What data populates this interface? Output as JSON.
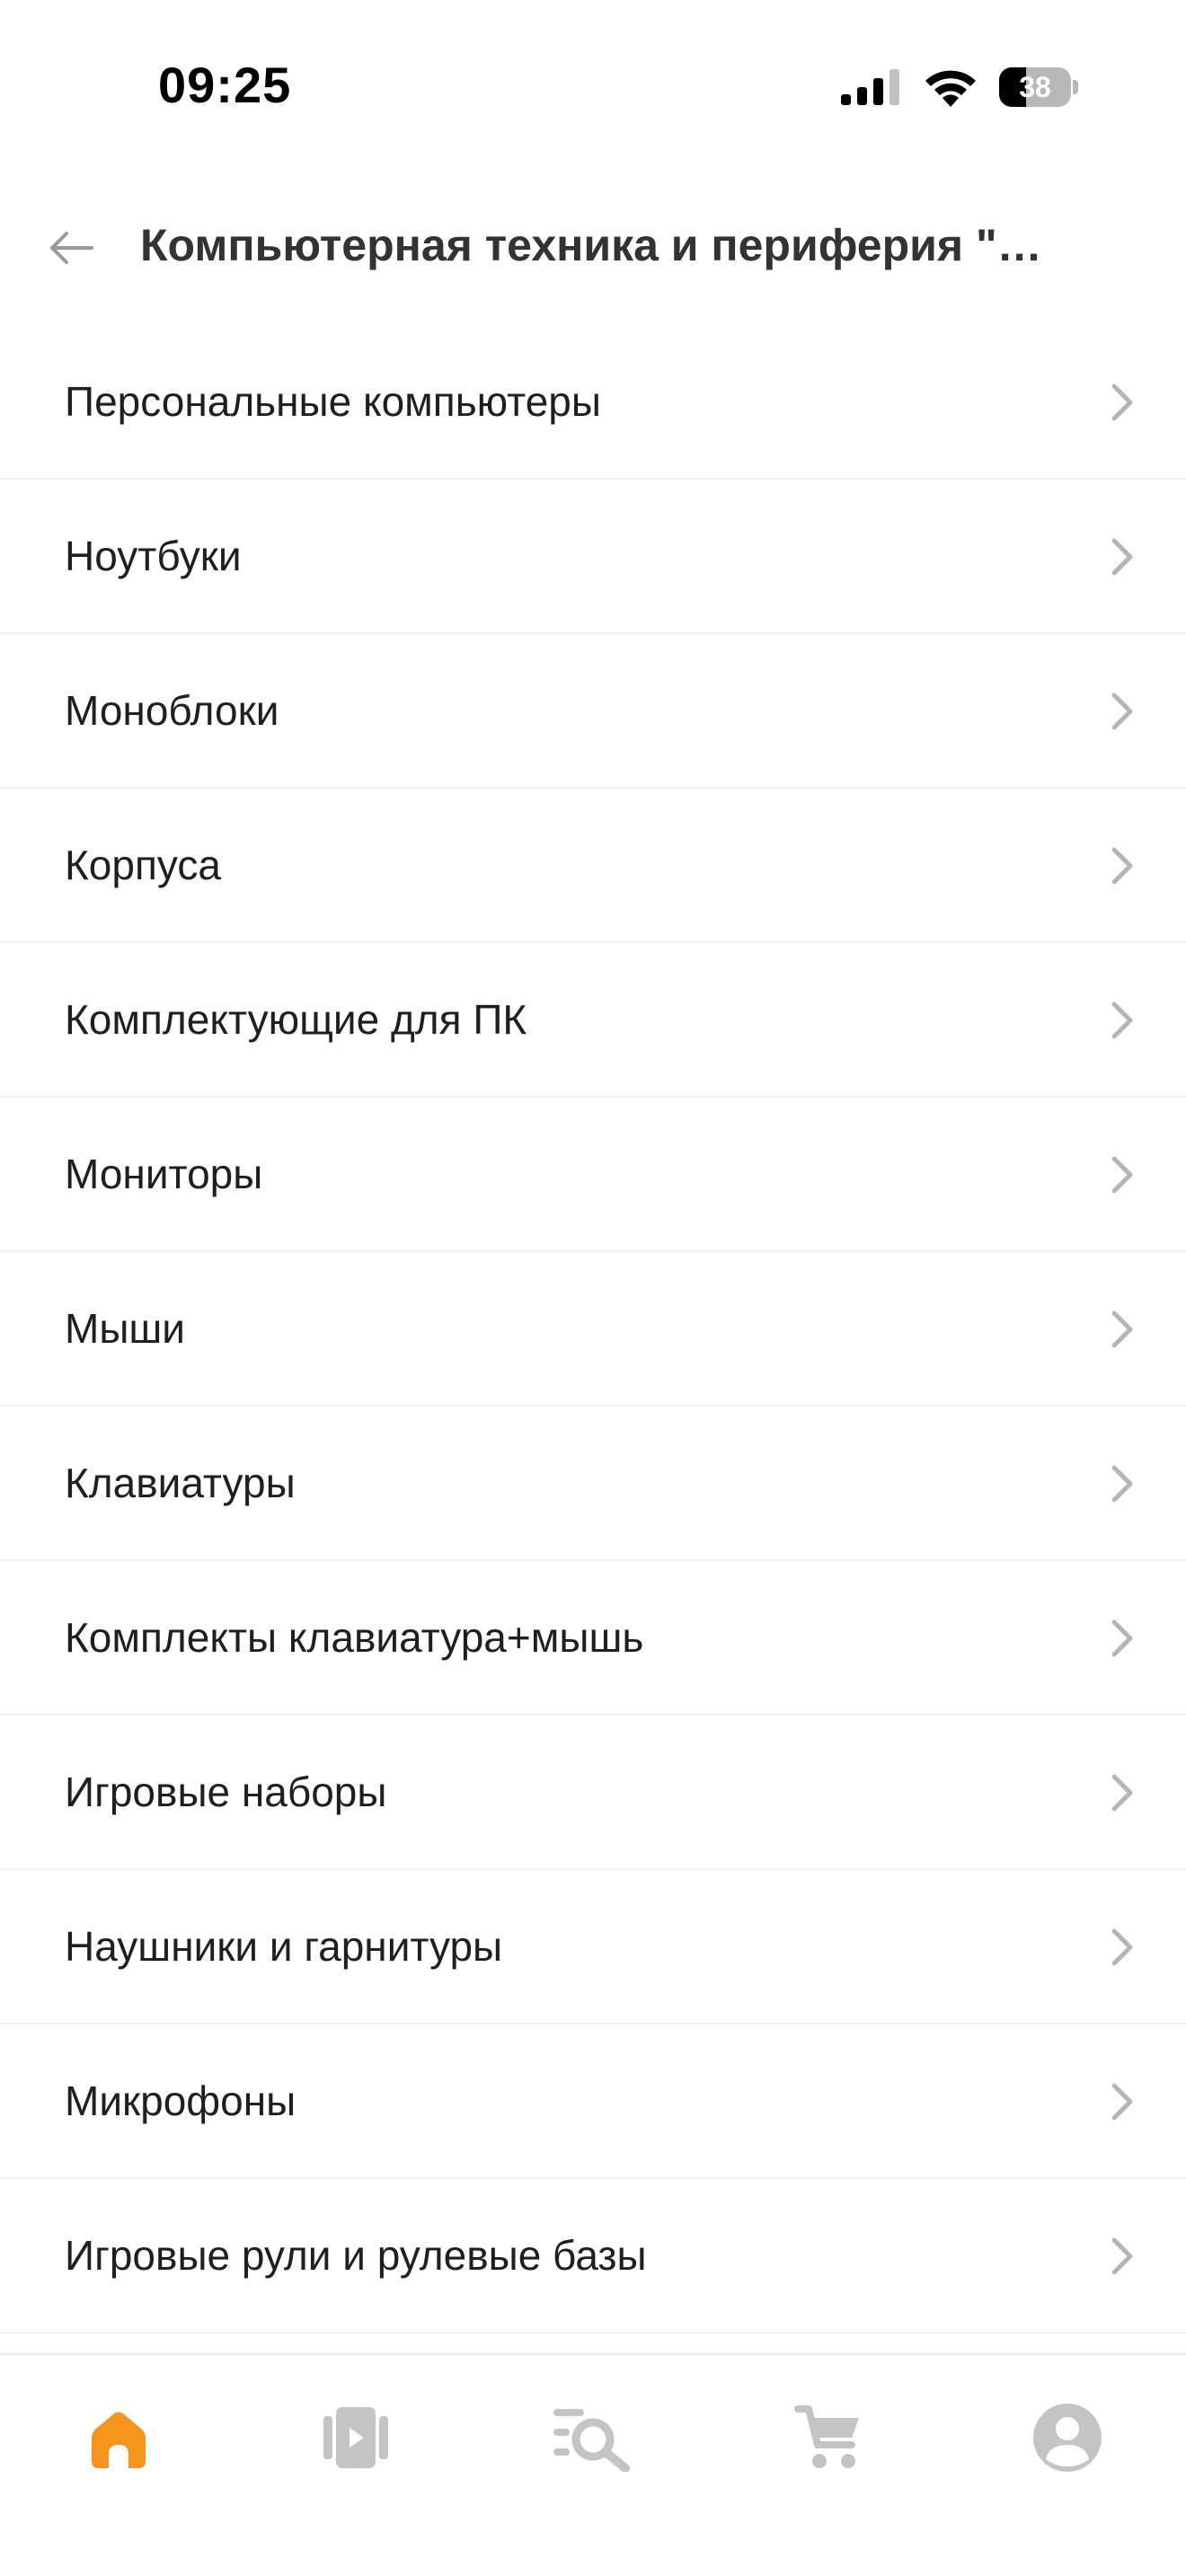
{
  "status_bar": {
    "time": "09:25",
    "battery_level": "38"
  },
  "header": {
    "title": "Компьютерная техника и периферия \"Со..."
  },
  "categories": [
    {
      "label": "Персональные компьютеры"
    },
    {
      "label": "Ноутбуки"
    },
    {
      "label": "Моноблоки"
    },
    {
      "label": "Корпуса"
    },
    {
      "label": "Комплектующие для ПК"
    },
    {
      "label": "Мониторы"
    },
    {
      "label": "Мыши"
    },
    {
      "label": "Клавиатуры"
    },
    {
      "label": "Комплекты клавиатура+мышь"
    },
    {
      "label": "Игровые наборы"
    },
    {
      "label": "Наушники и гарнитуры"
    },
    {
      "label": "Микрофоны"
    },
    {
      "label": "Игровые рули и рулевые базы"
    }
  ],
  "bottom_nav": {
    "items": [
      {
        "icon": "home-icon",
        "active": true
      },
      {
        "icon": "video-icon",
        "active": false
      },
      {
        "icon": "catalog-search-icon",
        "active": false
      },
      {
        "icon": "cart-icon",
        "active": false
      },
      {
        "icon": "profile-icon",
        "active": false
      }
    ]
  },
  "colors": {
    "accent": "#f7941d",
    "inactive_icon": "#c4c4c4",
    "text": "#1f1f1f",
    "divider": "#f0f0f0"
  }
}
